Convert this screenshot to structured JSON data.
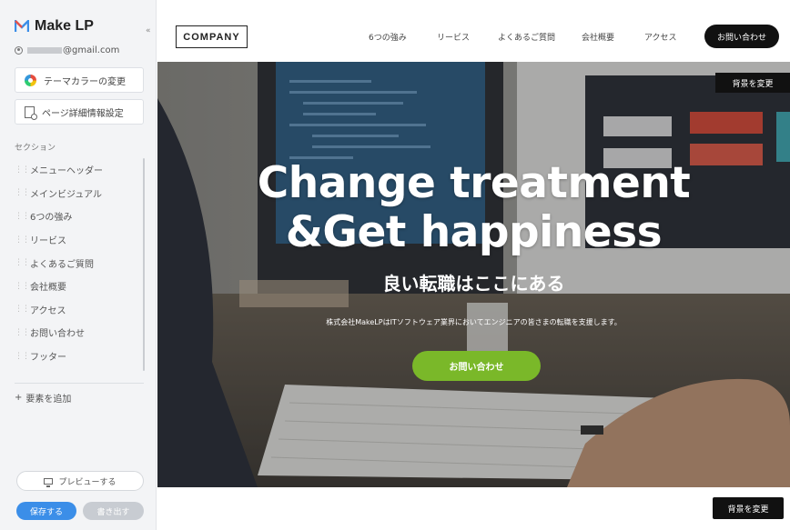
{
  "sidebar": {
    "brand": "Make LP",
    "account_email": "@gmail.com",
    "theme_color_button": "テーマカラーの変更",
    "page_settings_button": "ページ詳細情報設定",
    "sections_label": "セクション",
    "sections": [
      {
        "label": "メニューヘッダー"
      },
      {
        "label": "メインビジュアル"
      },
      {
        "label": "6つの強み"
      },
      {
        "label": "リービス"
      },
      {
        "label": "よくあるご質問"
      },
      {
        "label": "会社概要"
      },
      {
        "label": "アクセス"
      },
      {
        "label": "お問い合わせ"
      },
      {
        "label": "フッター"
      }
    ],
    "add_element": "要素を追加",
    "preview_button": "プレビューする",
    "save_button": "保存する",
    "export_button": "書き出す"
  },
  "site": {
    "logo": "COMPANY",
    "nav": [
      "6つの強み",
      "リービス",
      "よくあるご質問",
      "会社概要",
      "アクセス"
    ],
    "header_cta": "お問い合わせ",
    "hero": {
      "headline_line1": "Change treatment",
      "headline_line2": "&Get happiness",
      "subtitle": "良い転職はここにある",
      "description": "株式会社MakeLPはITソフトウェア業界においてエンジニアの皆さまの転職を支援します。",
      "cta": "お問い合わせ",
      "bg_change_top": "背景を変更"
    },
    "bg_change_bottom": "背景を変更"
  },
  "colors": {
    "accent_blue": "#3b8ee8",
    "cta_green": "#7ab829",
    "dark": "#111111"
  }
}
